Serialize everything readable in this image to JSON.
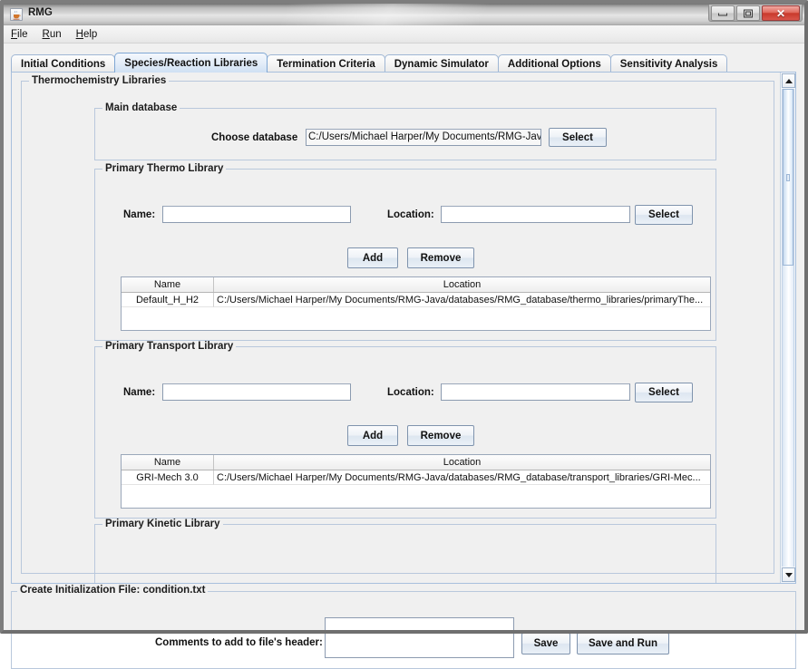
{
  "window": {
    "title": "RMG",
    "icon": "java-coffee-cup-icon",
    "buttons": {
      "minimize": "minimize-icon",
      "maximize": "maximize-icon",
      "close": "✕"
    }
  },
  "menubar": {
    "items": [
      {
        "label": "File",
        "mnemonic": "F"
      },
      {
        "label": "Run",
        "mnemonic": "R"
      },
      {
        "label": "Help",
        "mnemonic": "H"
      }
    ]
  },
  "tabs": [
    {
      "label": "Initial Conditions",
      "selected": false
    },
    {
      "label": "Species/Reaction Libraries",
      "selected": true
    },
    {
      "label": "Termination Criteria",
      "selected": false
    },
    {
      "label": "Dynamic Simulator",
      "selected": false
    },
    {
      "label": "Additional Options",
      "selected": false
    },
    {
      "label": "Sensitivity Analysis",
      "selected": false
    }
  ],
  "panel": {
    "title": "Thermochemistry Libraries",
    "main_database": {
      "title": "Main database",
      "label": "Choose database",
      "value": "C:/Users/Michael Harper/My Documents/RMG-Java",
      "select_label": "Select"
    },
    "primary_thermo_library": {
      "title": "Primary Thermo Library",
      "name_label": "Name:",
      "name_value": "",
      "location_label": "Location:",
      "location_value": "",
      "select_label": "Select",
      "add_label": "Add",
      "remove_label": "Remove",
      "table": {
        "headers": [
          "Name",
          "Location"
        ],
        "rows": [
          {
            "name": "Default_H_H2",
            "location": "C:/Users/Michael Harper/My Documents/RMG-Java/databases/RMG_database/thermo_libraries/primaryThe..."
          }
        ]
      }
    },
    "primary_transport_library": {
      "title": "Primary Transport Library",
      "name_label": "Name:",
      "name_value": "",
      "location_label": "Location:",
      "location_value": "",
      "select_label": "Select",
      "add_label": "Add",
      "remove_label": "Remove",
      "table": {
        "headers": [
          "Name",
          "Location"
        ],
        "rows": [
          {
            "name": "GRI-Mech 3.0",
            "location": "C:/Users/Michael Harper/My Documents/RMG-Java/databases/RMG_database/transport_libraries/GRI-Mec..."
          }
        ]
      }
    },
    "primary_kinetic_library": {
      "title": "Primary Kinetic Library"
    },
    "scrollbar": {
      "up_icon": "triangle-up-icon",
      "down_icon": "triangle-down-icon"
    }
  },
  "bottom": {
    "title": "Create Initialization File: condition.txt",
    "comments_label": "Comments to add to file's header:",
    "comments_value": "",
    "save_label": "Save",
    "save_and_run_label": "Save and Run"
  }
}
